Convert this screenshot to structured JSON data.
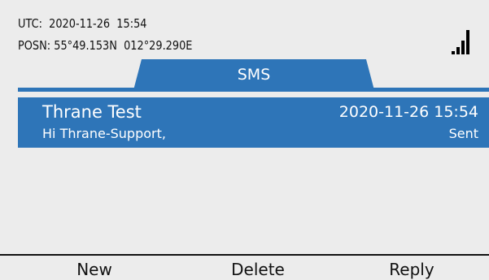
{
  "status": {
    "utc_label": "UTC:",
    "utc_value": "2020-11-26  15:54",
    "posn_label": "POSN:",
    "posn_value": "55°49.153N  012°29.290E",
    "signal_icon": "signal-strength-icon",
    "signal_bars_lit": 4,
    "signal_bars_total": 4
  },
  "tab": {
    "label": "SMS",
    "color": "#2e75b8"
  },
  "messages": [
    {
      "title": "Thrane Test",
      "date": "2020-11-26 15:54",
      "preview": "Hi Thrane-Support,",
      "status": "Sent",
      "selected": true
    }
  ],
  "softkeys": {
    "left": "New",
    "center": "Delete",
    "right": "Reply"
  },
  "colors": {
    "accent": "#2e75b8",
    "background": "#ececec",
    "text": "#111111",
    "selected_text": "#ffffff"
  }
}
